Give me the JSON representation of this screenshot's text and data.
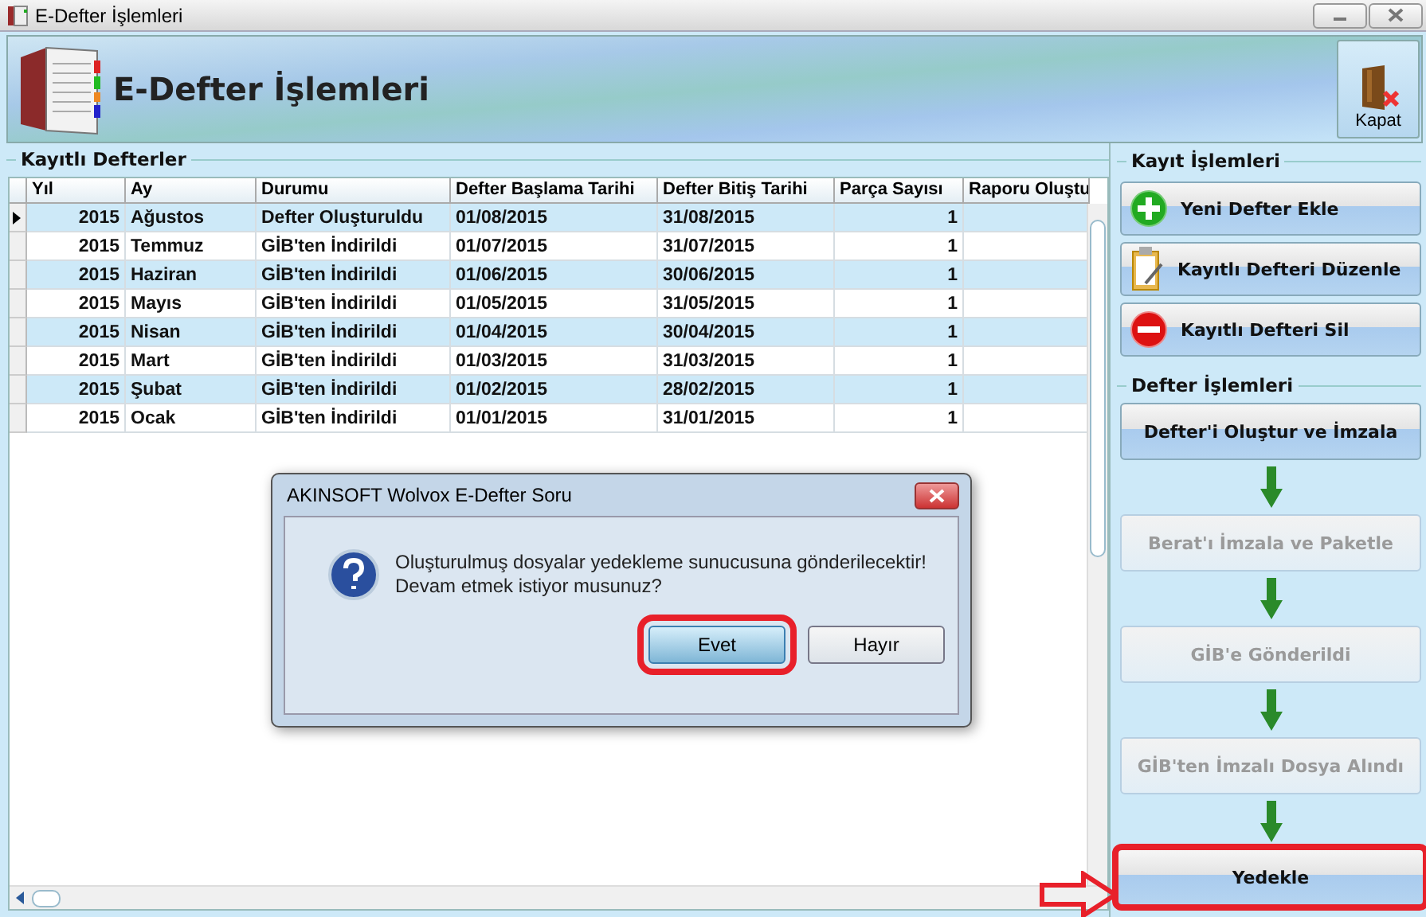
{
  "window": {
    "title": "E-Defter İşlemleri"
  },
  "header": {
    "title": "E-Defter İşlemleri",
    "close_button": "Kapat"
  },
  "records": {
    "title": "Kayıtlı Defterler",
    "columns": [
      "Yıl",
      "Ay",
      "Durumu",
      "Defter Başlama Tarihi",
      "Defter Bitiş Tarihi",
      "Parça Sayısı",
      "Raporu Oluştu"
    ],
    "rows": [
      {
        "cells": [
          "2015",
          "Ağustos",
          "Defter Oluşturuldu",
          "01/08/2015",
          "31/08/2015",
          "1"
        ],
        "selected": true
      },
      {
        "cells": [
          "2015",
          "Temmuz",
          "GİB'ten İndirildi",
          "01/07/2015",
          "31/07/2015",
          "1"
        ],
        "selected": false
      },
      {
        "cells": [
          "2015",
          "Haziran",
          "GİB'ten İndirildi",
          "01/06/2015",
          "30/06/2015",
          "1"
        ],
        "selected": false
      },
      {
        "cells": [
          "2015",
          "Mayıs",
          "GİB'ten İndirildi",
          "01/05/2015",
          "31/05/2015",
          "1"
        ],
        "selected": false
      },
      {
        "cells": [
          "2015",
          "Nisan",
          "GİB'ten İndirildi",
          "01/04/2015",
          "30/04/2015",
          "1"
        ],
        "selected": false
      },
      {
        "cells": [
          "2015",
          "Mart",
          "GİB'ten İndirildi",
          "01/03/2015",
          "31/03/2015",
          "1"
        ],
        "selected": false
      },
      {
        "cells": [
          "2015",
          "Şubat",
          "GİB'ten İndirildi",
          "01/02/2015",
          "28/02/2015",
          "1"
        ],
        "selected": false
      },
      {
        "cells": [
          "2015",
          "Ocak",
          "GİB'ten İndirildi",
          "01/01/2015",
          "31/01/2015",
          "1"
        ],
        "selected": false
      }
    ]
  },
  "record_actions": {
    "title": "Kayıt İşlemleri",
    "buttons": [
      {
        "label": "Yeni Defter Ekle",
        "kind": "add"
      },
      {
        "label": "Kayıtlı Defteri Düzenle",
        "kind": "edit"
      },
      {
        "label": "Kayıtlı Defteri Sil",
        "kind": "delete"
      }
    ]
  },
  "ledger_actions": {
    "title": "Defter İşlemleri",
    "steps": [
      {
        "label": "Defter'i Oluştur ve İmzala",
        "disabled": false,
        "highlighted": false
      },
      {
        "label": "Berat'ı İmzala ve Paketle",
        "disabled": true,
        "highlighted": false
      },
      {
        "label": "GİB'e Gönderildi",
        "disabled": true,
        "highlighted": false
      },
      {
        "label": "GİB'ten İmzalı Dosya Alındı",
        "disabled": true,
        "highlighted": false
      },
      {
        "label": "Yedekle",
        "disabled": false,
        "highlighted": true
      }
    ]
  },
  "dialog": {
    "title": "AKINSOFT Wolvox E-Defter Soru",
    "message": [
      "Oluşturulmuş dosyalar yedekleme sunucusuna gönderilecektir!",
      "Devam etmek istiyor musunuz?"
    ],
    "buttons": [
      {
        "label": "Evet",
        "highlighted": true
      },
      {
        "label": "Hayır",
        "highlighted": false
      }
    ]
  }
}
